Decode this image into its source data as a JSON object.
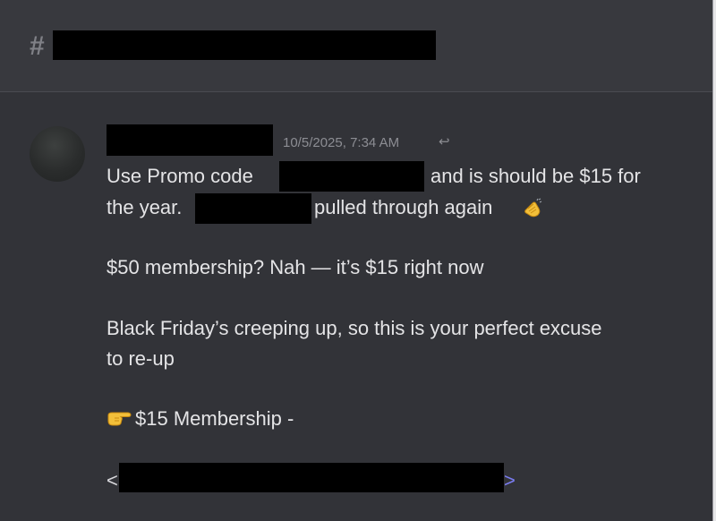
{
  "channel": {
    "icon": "hash-icon",
    "hash_symbol": "#",
    "name": ""
  },
  "message": {
    "username": "",
    "timestamp": "10/5/2025, 7:34 AM",
    "reply_icon": "↩",
    "line1_a": "Use Promo code",
    "line1_b": "and is should be $15 for",
    "line2_a": "the year.",
    "line2_b": "pulled through again",
    "line3": "$50 membership? Nah — it’s $15 right now",
    "line4": "Black Friday’s creeping up, so this is your perfect excuse",
    "line5": "to re-up",
    "line6": "$15 Membership -",
    "link_open": "<",
    "link_close": ">",
    "emoji": {
      "clap": "clapping-hands-icon",
      "point": "backhand-index-pointing-right-icon"
    }
  },
  "colors": {
    "background": "#323338",
    "header": "#38393e",
    "text": "#e4e4e6",
    "muted": "#8c8d93",
    "link": "#7a7cf0"
  }
}
